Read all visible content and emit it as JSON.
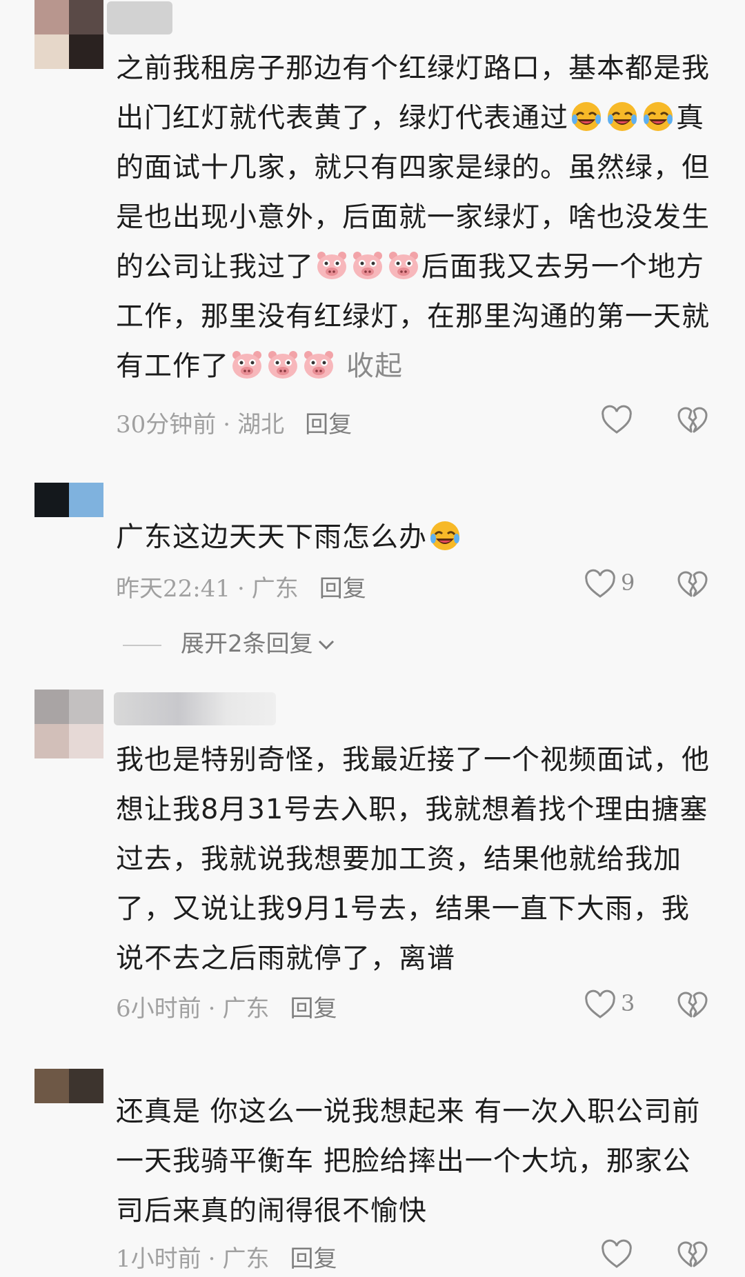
{
  "comments": [
    {
      "text_parts": [
        "之前我租房子那边有个红绿灯路口，基本都是我出门红灯就代表黄了，绿灯代表通过",
        "真的面试十几家，就只有四家是绿的。虽然绿，但是也出现小意外，后面就一家绿灯，啥也没发生的公司让我过了",
        "后面我又去另一个地方工作，那里没有红绿灯，在那里沟通的第一天就有工作了"
      ],
      "collapse_label": "收起",
      "time": "30分钟前",
      "location": "湖北",
      "reply_label": "回复",
      "likes": ""
    },
    {
      "text": "广东这边天天下雨怎么办",
      "time": "昨天22:41",
      "location": "广东",
      "reply_label": "回复",
      "likes": "9",
      "expand_label": "展开2条回复"
    },
    {
      "text": "我也是特别奇怪，我最近接了一个视频面试，他想让我8月31号去入职，我就想着找个理由搪塞过去，我就说我想要加工资，结果他就给我加了，又说让我9月1号去，结果一直下大雨，我说不去之后雨就停了，离谱",
      "time": "6小时前",
      "location": "广东",
      "reply_label": "回复",
      "likes": "3"
    },
    {
      "text": "还真是 你这么一说我想起来 有一次入职公司前一天我骑平衡车 把脸给摔出一个大坑，那家公司后来真的闹得很不愉快",
      "time": "1小时前",
      "location": "广东",
      "reply_label": "回复",
      "likes": ""
    }
  ],
  "icons": {
    "emoji_laugh": "laugh-cry-emoji-icon",
    "emoji_pig": "pig-face-emoji-icon",
    "like": "heart-icon",
    "dislike": "broken-heart-icon",
    "expand": "chevron-down-icon"
  },
  "colors": {
    "text": "#1d1d1d",
    "meta": "#a0a0a0",
    "background": "#f8f8f8"
  }
}
